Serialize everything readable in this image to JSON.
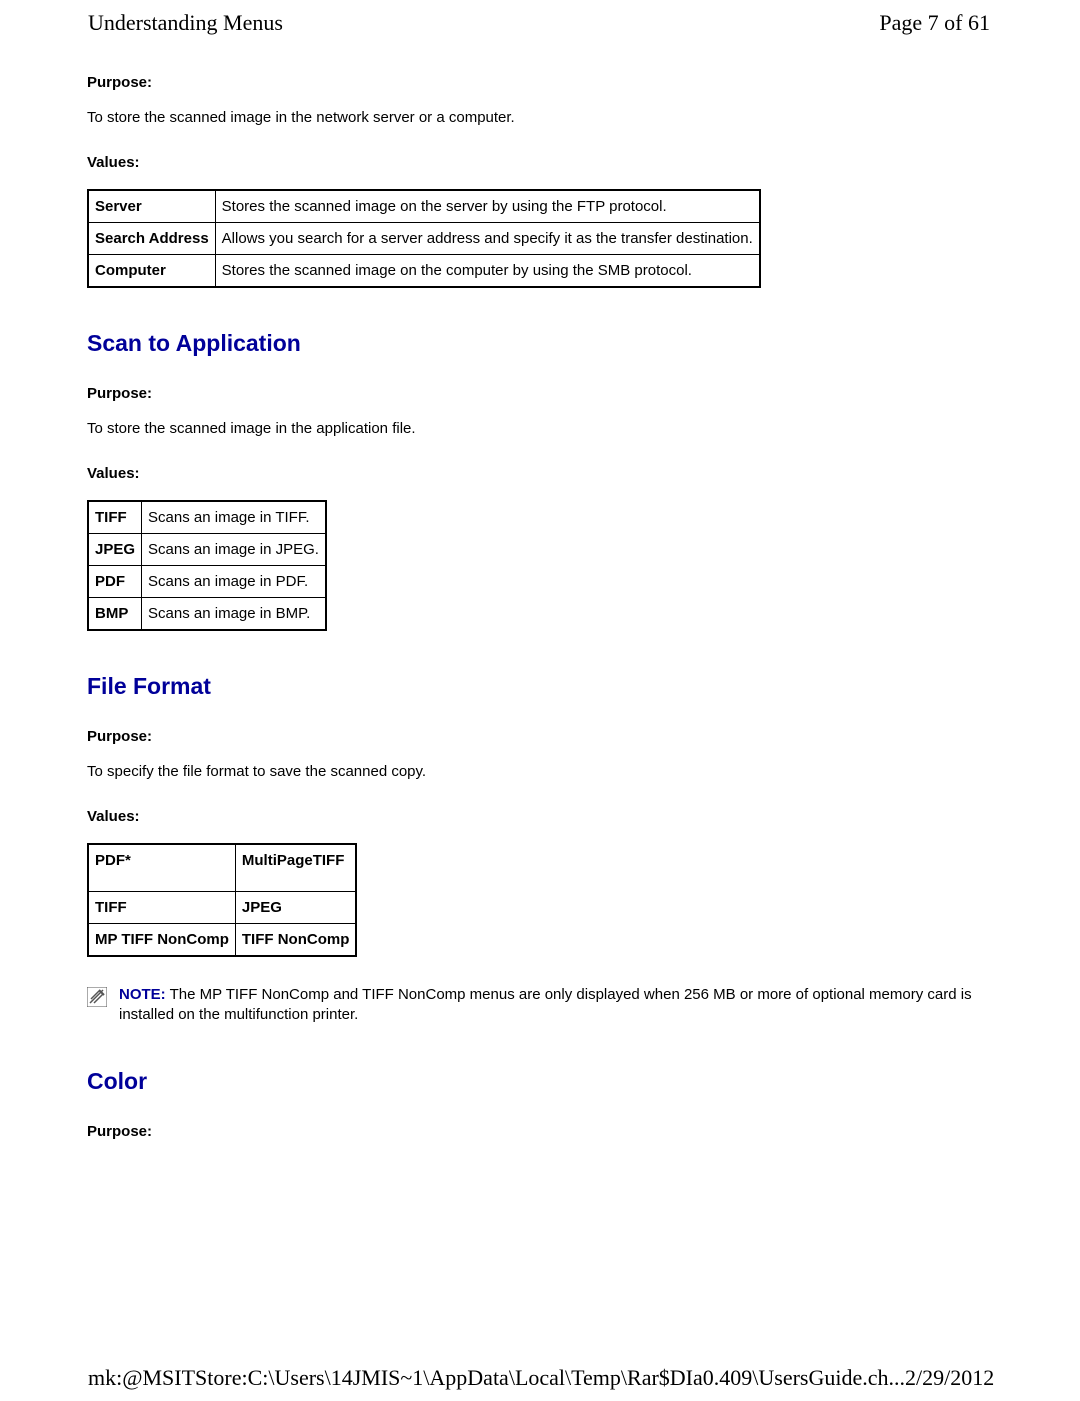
{
  "header": {
    "title": "Understanding Menus",
    "page": "Page 7 of 61"
  },
  "section1": {
    "purpose_label": "Purpose:",
    "purpose_text": "To store the scanned image in the network server or a computer.",
    "values_label": "Values:",
    "rows": [
      {
        "key": "Server",
        "val": "Stores the scanned image on the server by using the FTP protocol."
      },
      {
        "key": "Search Address",
        "val": "Allows you search for a server address and specify it as the transfer destination."
      },
      {
        "key": "Computer",
        "val": "Stores the scanned image on the computer by using the SMB protocol."
      }
    ]
  },
  "section2": {
    "heading": "Scan to Application",
    "purpose_label": "Purpose:",
    "purpose_text": "To store the scanned image in the application file.",
    "values_label": "Values:",
    "rows": [
      {
        "key": "TIFF",
        "val": "Scans an image in TIFF."
      },
      {
        "key": "JPEG",
        "val": "Scans an image in JPEG."
      },
      {
        "key": "PDF",
        "val": "Scans an image in PDF."
      },
      {
        "key": "BMP",
        "val": "Scans an image in BMP."
      }
    ]
  },
  "section3": {
    "heading": "File Format",
    "purpose_label": "Purpose:",
    "purpose_text": "To specify the file format to save the scanned copy.",
    "values_label": "Values:",
    "grid": [
      [
        "PDF*",
        "MultiPageTIFF"
      ],
      [
        "TIFF",
        "JPEG"
      ],
      [
        "MP TIFF NonComp",
        "TIFF NonComp"
      ]
    ],
    "note_label": "NOTE:",
    "note_text": " The MP TIFF NonComp and TIFF NonComp menus are only displayed when 256 MB or more of optional memory card is installed on the multifunction printer."
  },
  "section4": {
    "heading": "Color",
    "purpose_label": "Purpose:"
  },
  "footer": {
    "path": "mk:@MSITStore:C:\\Users\\14JMIS~1\\AppData\\Local\\Temp\\Rar$DIa0.409\\UsersGuide.ch...",
    "date": "2/29/2012"
  }
}
